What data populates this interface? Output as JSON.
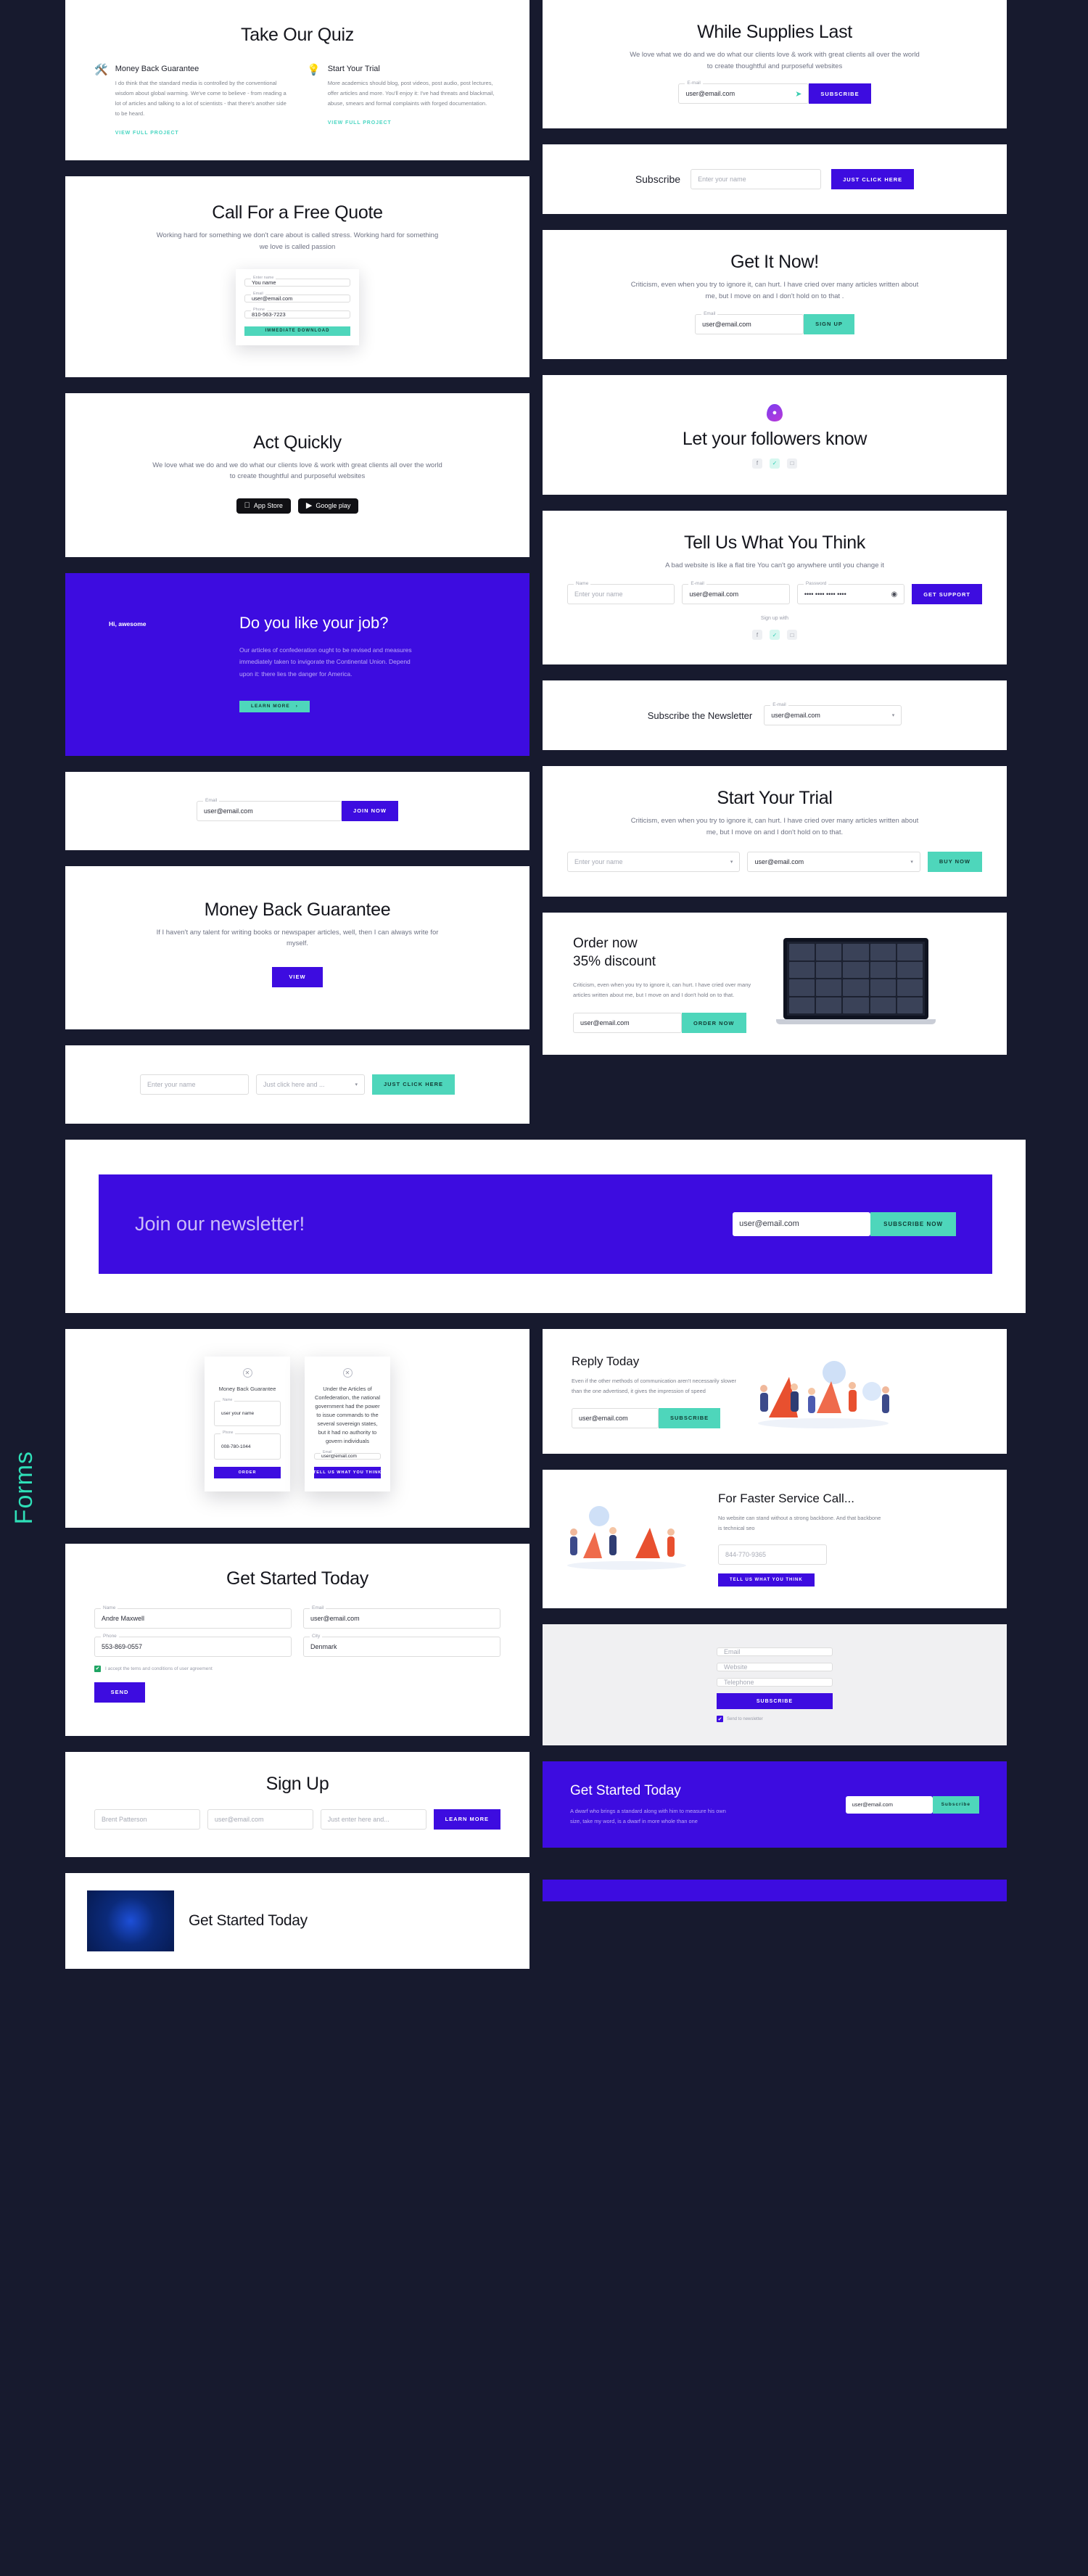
{
  "section_label": "Forms",
  "colors": {
    "purple": "#3d0ce0",
    "teal": "#4ed6bb",
    "dark": "#171a2e",
    "accent_link": "#49d6c2"
  },
  "left": {
    "quiz": {
      "title": "Take Our Quiz",
      "features": [
        {
          "icon": "tools-icon",
          "emoji": "🛠️",
          "heading": "Money Back Guarantee",
          "body": "I do think that the standard media is controlled by the conventional wisdom about global warming. We've come to believe - from reading a lot of articles and talking to a lot of scientists - that there's another side to be heard.",
          "link": "VIEW FULL PROJECT"
        },
        {
          "icon": "lightbulb-icon",
          "emoji": "💡",
          "heading": "Start Your Trial",
          "body": "More academics should blog, post videos, post audio, post lectures, offer articles and more. You'll enjoy it: I've had threats and blackmail, abuse, smears and formal complaints with forged documentation.",
          "link": "VIEW FULL PROJECT"
        }
      ]
    },
    "quote": {
      "title": "Call For a Free Quote",
      "subtitle": "Working hard for something we don't care about is called stress. Working hard for something we love is called passion",
      "fields": [
        {
          "label": "Enter name",
          "value": "You name"
        },
        {
          "label": "Email",
          "value": "user@email.com"
        },
        {
          "label": "Phone",
          "value": "810-563-7223"
        }
      ],
      "button": "IMMEDIATE DOWNLOAD"
    },
    "act": {
      "title": "Act Quickly",
      "subtitle": "We love what we do and we do what our clients love & work with great clients all over the world to create thoughtful and purposeful websites",
      "stores": [
        {
          "icon": "apple-icon",
          "glyph": "",
          "label": "App Store"
        },
        {
          "icon": "google-play-icon",
          "glyph": "▶",
          "label": "Google play"
        }
      ]
    },
    "job": {
      "eyebrow": "Hi, awesome",
      "title": "Do you like your job?",
      "body": "Our articles of confederation ought to be revised and measures immediately taken to invigorate the Continental Union. Depend upon it: there lies the danger for America.",
      "button": "LEARN MORE",
      "button_arrow": "›"
    },
    "join_now": {
      "field": {
        "label": "Email",
        "value": "user@email.com"
      },
      "button": "JOIN NOW"
    },
    "money_back": {
      "title": "Money Back Guarantee",
      "subtitle": "If I haven't any talent for writing books or newspaper articles, well, then I can always write for myself.",
      "button": "VIEW"
    },
    "just_click": {
      "name_field": {
        "placeholder": "Enter your name"
      },
      "select_field": {
        "value": "Just click here and ...",
        "caret": "▾"
      },
      "button": "JUST CLICK HERE"
    },
    "newsletter": {
      "title": "Join our newsletter!",
      "field": {
        "value": "user@email.com"
      },
      "button": "SUBSCRIBE NOW"
    },
    "modals": [
      {
        "close": "✕",
        "heading": "Money Back Guarantee",
        "fields": [
          {
            "label": "Name",
            "value": "user your name"
          },
          {
            "label": "Phone",
            "value": "008-780-1044"
          }
        ],
        "button": "ORDER"
      },
      {
        "close": "✕",
        "heading": "Under the Articles of Confederation, the national government had the power to issue commands to the several sovereign states, but it had no authority to govern individuals",
        "fields": [
          {
            "label": "Email",
            "value": "user@email.com"
          }
        ],
        "button": "TELL US WHAT YOU THINK"
      }
    ],
    "get_started": {
      "title": "Get Started Today",
      "fields": [
        {
          "label": "Name",
          "value": "Andre Maxwell"
        },
        {
          "label": "Email",
          "value": "user@email.com"
        },
        {
          "label": "Phone",
          "value": "553-869-0557"
        },
        {
          "label": "City",
          "value": "Denmark"
        }
      ],
      "checkbox_label": "I accept the tems and conditions of user agreement",
      "checkbox_glyph": "✔",
      "button": "SEND"
    },
    "sign_up": {
      "title": "Sign Up",
      "fields": [
        {
          "placeholder": "Brent Patterson"
        },
        {
          "placeholder": "user@email.com"
        },
        {
          "placeholder": "Just enter here and..."
        }
      ],
      "button": "LEARN MORE"
    },
    "get_started_bottom": {
      "title": "Get Started Today"
    }
  },
  "right": {
    "supplies": {
      "title": "While Supplies Last",
      "subtitle": "We love what we do and we do what our clients love & work with great clients all over the world to create thoughtful and purposeful websites",
      "field": {
        "label": "E-mail",
        "value": "user@email.com",
        "icon": "send-icon",
        "glyph": "➤"
      },
      "button": "SUBSCRIBE"
    },
    "subscribe_row": {
      "label": "Subscribe",
      "field": {
        "placeholder": "Enter your name"
      },
      "button": "JUST CLICK HERE"
    },
    "get_it_now": {
      "title": "Get It Now!",
      "subtitle": "Criticism, even when you try to ignore it, can hurt. I have cried over many articles written about me, but I move on and I don't hold on to that .",
      "field": {
        "label": "Email",
        "value": "user@email.com"
      },
      "button": "SIGN UP"
    },
    "followers": {
      "icon": "flame-icon",
      "glyph": "●",
      "title": "Let your followers know",
      "socials": [
        {
          "name": "facebook-icon",
          "glyph": "f"
        },
        {
          "name": "twitter-icon",
          "glyph": "✓"
        },
        {
          "name": "instagram-icon",
          "glyph": "□"
        }
      ]
    },
    "tell_us": {
      "title": "Tell Us What You Think",
      "subtitle": "A bad website is like a flat tire You can't go anywhere until you change it",
      "fields": [
        {
          "label": "Name",
          "value": "Enter your name",
          "placeholder": true
        },
        {
          "label": "E-mail",
          "value": "user@email.com"
        },
        {
          "label": "Password",
          "value": "•••• •••• •••• ••••",
          "icon": "eye-icon",
          "glyph": "◉"
        }
      ],
      "button": "GET SUPPORT",
      "signup_with": "Sign up with",
      "socials": [
        {
          "name": "facebook-icon",
          "glyph": "f"
        },
        {
          "name": "twitter-icon",
          "glyph": "✓"
        },
        {
          "name": "instagram-icon",
          "glyph": "□"
        }
      ]
    },
    "subscribe_newsletter": {
      "label": "Subscribe the Newsletter",
      "field": {
        "label": "E-mail",
        "value": "user@email.com",
        "caret": "▾"
      }
    },
    "trial": {
      "title": "Start Your Trial",
      "subtitle": "Criticism, even when you try to ignore it, can hurt. I have cried over many articles written about me, but I move on and I don't hold on to that.",
      "fields": [
        {
          "value": "Enter your name",
          "placeholder": true,
          "caret": "▾"
        },
        {
          "value": "user@email.com",
          "caret": "▾"
        }
      ],
      "button": "BUY NOW"
    },
    "order": {
      "title_line1": "Order now",
      "title_line2": "35% discount",
      "body": "Criticism, even when you try to ignore it, can hurt. I have cried over many articles written about me, but I move on and I don't hold on to that.",
      "field": {
        "value": "user@email.com"
      },
      "button": "ORDER NOW"
    },
    "reply": {
      "title": "Reply Today",
      "body": "Even if the other methods of communication aren't necessarily slower than the one advertised, it gives the impression of speed",
      "field": {
        "value": "user@email.com"
      },
      "button": "SUBSCRIBE"
    },
    "faster": {
      "title": "For Faster Service Call...",
      "body": "No website can stand without a strong backbone. And that backbone is technical seo",
      "field": {
        "placeholder": "844-770-9365"
      },
      "button": "TELL US WHAT YOU THINK"
    },
    "grey_form": {
      "fields": [
        {
          "placeholder": "Email"
        },
        {
          "placeholder": "Website"
        },
        {
          "placeholder": "Telephone"
        }
      ],
      "button": "SUBSCRIBE",
      "checkbox_label": "Send to newsletter",
      "checkbox_glyph": "✔"
    },
    "purple_started": {
      "title": "Get Started Today",
      "body": "A dwarf who brings a standard along with him to measure his own size, take my word, is a dwarf in more whole than one",
      "field": {
        "value": "user@email.com"
      },
      "button": "Subscribe"
    }
  }
}
